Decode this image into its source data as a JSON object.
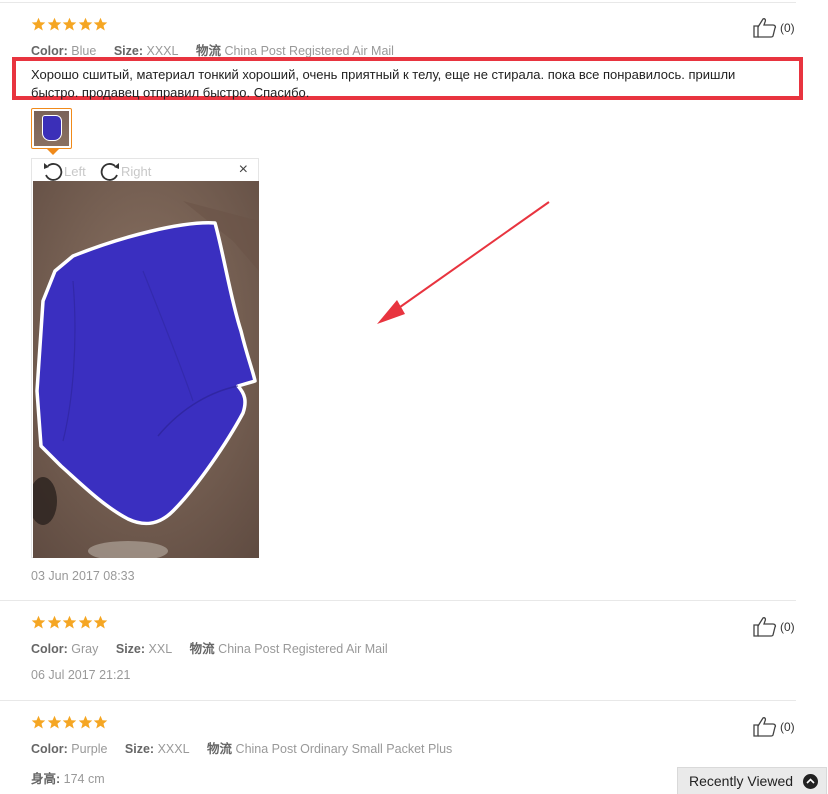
{
  "reviews": [
    {
      "rating": 5,
      "color_label": "Color:",
      "color": "Blue",
      "size_label": "Size:",
      "size": "XXXL",
      "shipping_label": "物流",
      "shipping": "China Post Registered Air Mail",
      "likes": "(0)",
      "text": "Хорошо сшитый, материал тонкий хороший, очень приятный к телу, еще не стирала. пока все понравилось. пришли быстро. продавец отправил быстро. Спасибо.",
      "date": "03 Jun 2017 08:33"
    },
    {
      "rating": 5,
      "color_label": "Color:",
      "color": "Gray",
      "size_label": "Size:",
      "size": "XXL",
      "shipping_label": "物流",
      "shipping": "China Post Registered Air Mail",
      "likes": "(0)",
      "date": "06 Jul 2017 21:21"
    },
    {
      "rating": 5,
      "color_label": "Color:",
      "color": "Purple",
      "size_label": "Size:",
      "size": "XXXL",
      "shipping_label": "物流",
      "shipping": "China Post Ordinary Small Packet Plus",
      "likes": "(0)",
      "height_label": "身高:",
      "height": "174 cm"
    }
  ],
  "viewer": {
    "rotate_left": "Left",
    "rotate_right": "Right",
    "close": "×"
  },
  "recently_viewed": "Recently Viewed",
  "colors": {
    "star": "#f5a623",
    "highlight_border": "#e8343f",
    "annotation_arrow": "#e8343f",
    "thumb_border": "#f08a1a"
  }
}
